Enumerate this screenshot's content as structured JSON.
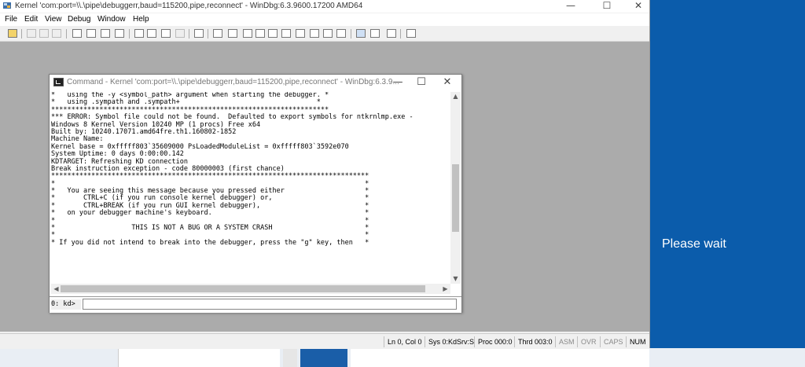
{
  "main_window": {
    "title": "Kernel 'com:port=\\\\.\\pipe\\debuggerr,baud=115200,pipe,reconnect' - WinDbg:6.3.9600.17200 AMD64",
    "minimize": "—",
    "maximize": "☐",
    "close": "✕"
  },
  "menu": {
    "items": [
      "File",
      "Edit",
      "View",
      "Debug",
      "Window",
      "Help"
    ]
  },
  "command_window": {
    "title": "Command - Kernel 'com:port=\\\\.\\pipe\\debuggerr,baud=115200,pipe,reconnect' - WinDbg:6.3.9...",
    "minimize": "—",
    "maximize": "☐",
    "close": "✕",
    "output_lines": [
      "*   using the -y <symbol_path> argument when starting the debugger. *",
      "*   using .sympath and .sympath+                                  *",
      "*********************************************************************",
      "*** ERROR: Symbol file could not be found.  Defaulted to export symbols for ntkrnlmp.exe -",
      "Windows 8 Kernel Version 10240 MP (1 procs) Free x64",
      "Built by: 10240.17071.amd64fre.th1.160802-1852",
      "Machine Name:",
      "Kernel base = 0xfffff803`35609000 PsLoadedModuleList = 0xfffff803`3592e070",
      "System Uptime: 0 days 0:00:00.142",
      "KDTARGET: Refreshing KD connection",
      "Break instruction exception - code 80000003 (first chance)",
      "*******************************************************************************",
      "*                                                                             *",
      "*   You are seeing this message because you pressed either                    *",
      "*       CTRL+C (if you run console kernel debugger) or,                       *",
      "*       CTRL+BREAK (if you run GUI kernel debugger),                          *",
      "*   on your debugger machine's keyboard.                                      *",
      "*                                                                             *",
      "*                   THIS IS NOT A BUG OR A SYSTEM CRASH                       *",
      "*                                                                             *",
      "* If you did not intend to break into the debugger, press the \"g\" key, then   *"
    ],
    "prompt": "0: kd>",
    "input_value": ""
  },
  "statusbar": {
    "cells": [
      {
        "label": "Ln 0, Col 0",
        "enabled": true
      },
      {
        "label": "Sys 0:KdSrv:S",
        "enabled": true
      },
      {
        "label": "Proc 000:0",
        "enabled": true
      },
      {
        "label": "Thrd 003:0",
        "enabled": true
      },
      {
        "label": "ASM",
        "enabled": false
      },
      {
        "label": "OVR",
        "enabled": false
      },
      {
        "label": "CAPS",
        "enabled": false
      },
      {
        "label": "NUM",
        "enabled": true
      }
    ]
  },
  "background": {
    "message": "Please wait"
  },
  "colors": {
    "desktop_blue": "#0b5cab",
    "workspace_gray": "#ababab"
  }
}
